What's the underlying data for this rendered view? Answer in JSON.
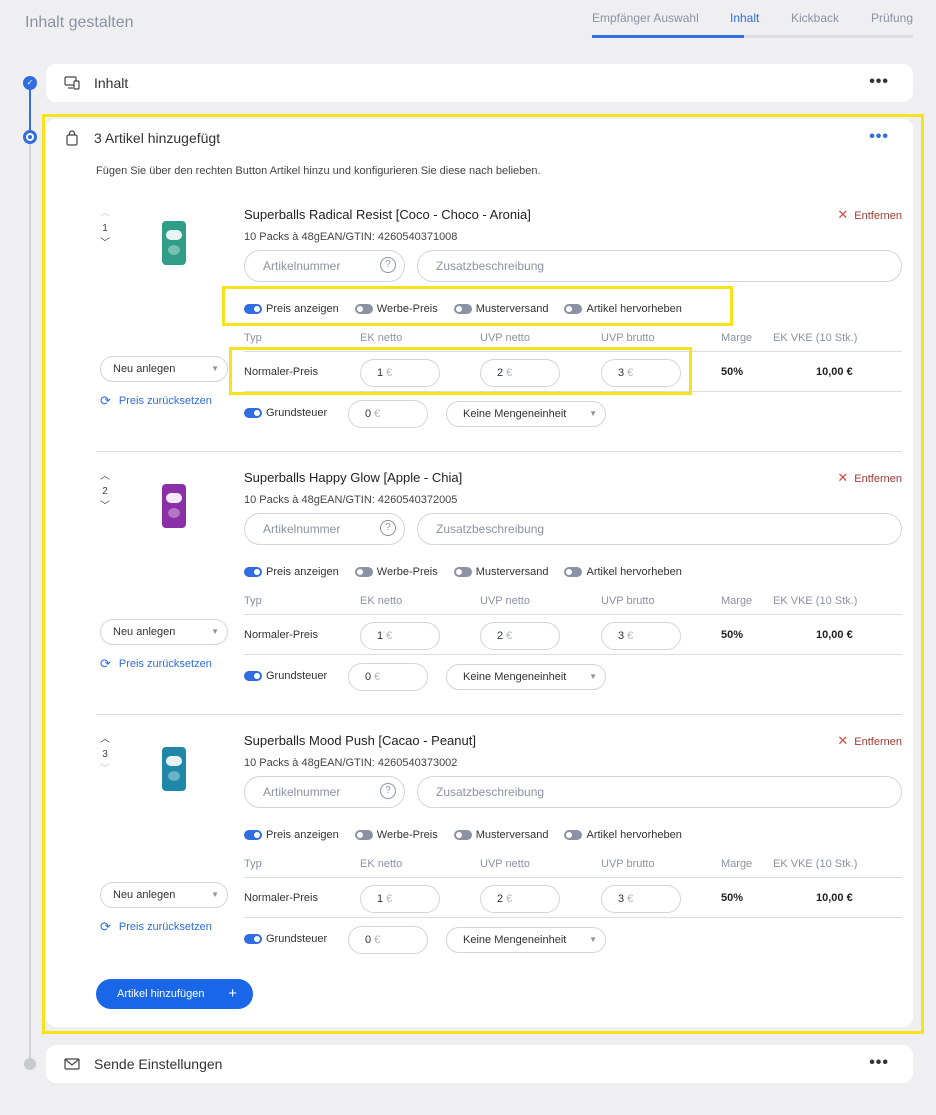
{
  "page": {
    "title": "Inhalt gestalten"
  },
  "tabs": [
    {
      "label": "Empfänger Auswahl"
    },
    {
      "label": "Inhalt"
    },
    {
      "label": "Kickback"
    },
    {
      "label": "Prüfung"
    }
  ],
  "sections": {
    "inhalt": {
      "title": "Inhalt"
    },
    "articles": {
      "title": "3 Artikel hinzugefügt",
      "description": "Fügen Sie über den rechten Button Artikel hinzu und konfigurieren Sie diese nach belieben."
    },
    "send": {
      "title": "Sende Einstellungen"
    }
  },
  "menu_dots": "•••",
  "labels": {
    "remove": "Entfernen",
    "article_number_placeholder": "Artikelnummer",
    "additional_description_placeholder": "Zusatzbeschreibung",
    "help": "?",
    "toggle_show_price": "Preis anzeigen",
    "toggle_promo_price": "Werbe-Preis",
    "toggle_sample_shipping": "Musterversand",
    "toggle_highlight": "Artikel hervorheben",
    "col_type": "Typ",
    "col_ek_netto": "EK netto",
    "col_uvp_netto": "UVP netto",
    "col_uvp_brutto": "UVP brutto",
    "col_margin": "Marge",
    "col_ek_vke": "EK VKE (10 Stk.)",
    "price_type": "Normaler-Preis",
    "currency": "€",
    "new_create": "Neu anlegen",
    "reset_price": "Preis zurücksetzen",
    "property_tax": "Grundsteuer",
    "unit_none": "Keine Mengeneinheit",
    "add_article": "Artikel hinzufügen",
    "up_chevron": "︿",
    "down_chevron": "﹀",
    "plus": "+",
    "x": "✕",
    "caret": "▼",
    "reset_symbol": "⟳",
    "check": "✓"
  },
  "articles": [
    {
      "position": "1",
      "name": "Superballs Radical Resist [Coco - Choco - Aronia]",
      "sub": "10 Packs à 48gEAN/GTIN: 4260540371008",
      "pack_color": "#2f9d87",
      "ek_netto": "1",
      "uvp_netto": "2",
      "uvp_brutto": "3",
      "margin": "50%",
      "ek_vke": "10,00 €",
      "grundsteuer": "0"
    },
    {
      "position": "2",
      "name": "Superballs Happy Glow [Apple - Chia]",
      "sub": "10 Packs à 48gEAN/GTIN: 4260540372005",
      "pack_color": "#8a2fa6",
      "ek_netto": "1",
      "uvp_netto": "2",
      "uvp_brutto": "3",
      "margin": "50%",
      "ek_vke": "10,00 €",
      "grundsteuer": "0"
    },
    {
      "position": "3",
      "name": "Superballs Mood Push [Cacao - Peanut]",
      "sub": "10 Packs à 48gEAN/GTIN: 4260540373002",
      "pack_color": "#1f87a8",
      "ek_netto": "1",
      "uvp_netto": "2",
      "uvp_brutto": "3",
      "margin": "50%",
      "ek_vke": "10,00 €",
      "grundsteuer": "0"
    }
  ],
  "colors": {
    "accent": "#2f6de0",
    "highlight": "#f8e21c",
    "danger": "#d9453a"
  }
}
